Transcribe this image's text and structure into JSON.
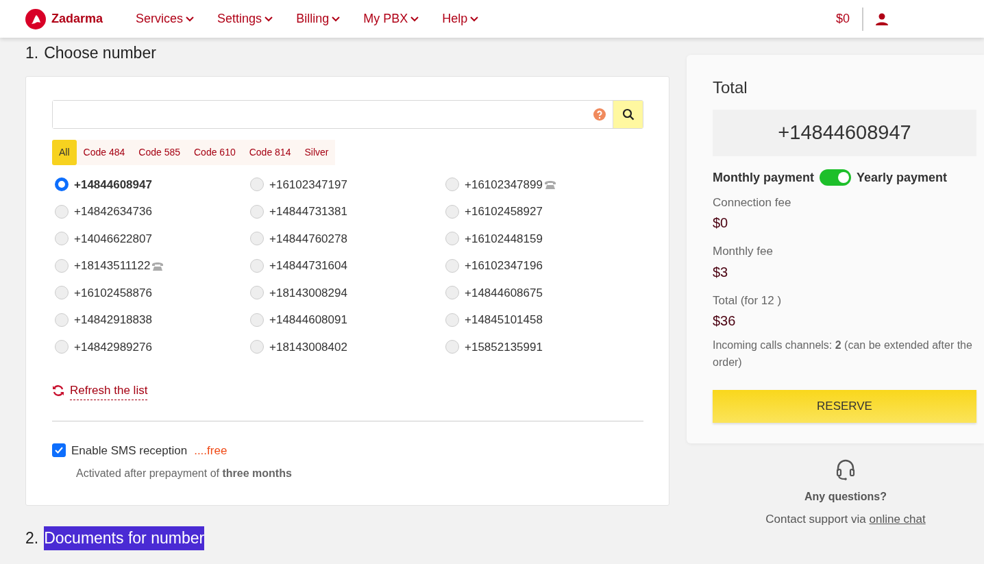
{
  "navbar": {
    "brand": "Zadarma",
    "menu": [
      {
        "label": "Services"
      },
      {
        "label": "Settings"
      },
      {
        "label": "Billing"
      },
      {
        "label": "My PBX"
      },
      {
        "label": "Help"
      }
    ],
    "balance": "$0"
  },
  "step1": {
    "number": "1.",
    "title": "Choose number"
  },
  "filters": [
    {
      "label": "All",
      "selected": true
    },
    {
      "label": "Code 484",
      "selected": false
    },
    {
      "label": "Code 585",
      "selected": false
    },
    {
      "label": "Code 610",
      "selected": false
    },
    {
      "label": "Code 814",
      "selected": false
    },
    {
      "label": "Silver",
      "selected": false
    }
  ],
  "numbers": [
    {
      "number": "+14844608947",
      "selected": true,
      "phone_icon": false
    },
    {
      "number": "+16102347197",
      "selected": false,
      "phone_icon": false
    },
    {
      "number": "+16102347899",
      "selected": false,
      "phone_icon": true
    },
    {
      "number": "+14842634736",
      "selected": false,
      "phone_icon": false
    },
    {
      "number": "+14844731381",
      "selected": false,
      "phone_icon": false
    },
    {
      "number": "+16102458927",
      "selected": false,
      "phone_icon": false
    },
    {
      "number": "+14046622807",
      "selected": false,
      "phone_icon": false
    },
    {
      "number": "+14844760278",
      "selected": false,
      "phone_icon": false
    },
    {
      "number": "+16102448159",
      "selected": false,
      "phone_icon": false
    },
    {
      "number": "+18143511122",
      "selected": false,
      "phone_icon": true
    },
    {
      "number": "+14844731604",
      "selected": false,
      "phone_icon": false
    },
    {
      "number": "+16102347196",
      "selected": false,
      "phone_icon": false
    },
    {
      "number": "+16102458876",
      "selected": false,
      "phone_icon": false
    },
    {
      "number": "+18143008294",
      "selected": false,
      "phone_icon": false
    },
    {
      "number": "+14844608675",
      "selected": false,
      "phone_icon": false
    },
    {
      "number": "+14842918838",
      "selected": false,
      "phone_icon": false
    },
    {
      "number": "+14844608091",
      "selected": false,
      "phone_icon": false
    },
    {
      "number": "+14845101458",
      "selected": false,
      "phone_icon": false
    },
    {
      "number": "+14842989276",
      "selected": false,
      "phone_icon": false
    },
    {
      "number": "+18143008402",
      "selected": false,
      "phone_icon": false
    },
    {
      "number": "+15852135991",
      "selected": false,
      "phone_icon": false
    }
  ],
  "refresh": {
    "label": "Refresh the list"
  },
  "sms": {
    "label": "Enable SMS reception",
    "price": "....free",
    "checked": true,
    "note": "Activated after prepayment of **three months**"
  },
  "total": {
    "title": "Total",
    "number": "+14844608947",
    "left_label": "Monthly payment",
    "right_label": "Yearly payment",
    "yearly": true,
    "fees": [
      {
        "label": "Connection fee",
        "value": "$0"
      },
      {
        "label": "Monthly fee",
        "value": "$3"
      },
      {
        "label": "Total (for 12 )",
        "value": "$36"
      }
    ],
    "channels": "Incoming calls channels: **2** (can be extended after the order)",
    "button": "RESERVE"
  },
  "support": {
    "question": "Any questions?",
    "text": "Contact support via",
    "link": "online chat"
  },
  "step2": {
    "number": "2.",
    "title": "Documents for number",
    "highlighted": true
  }
}
